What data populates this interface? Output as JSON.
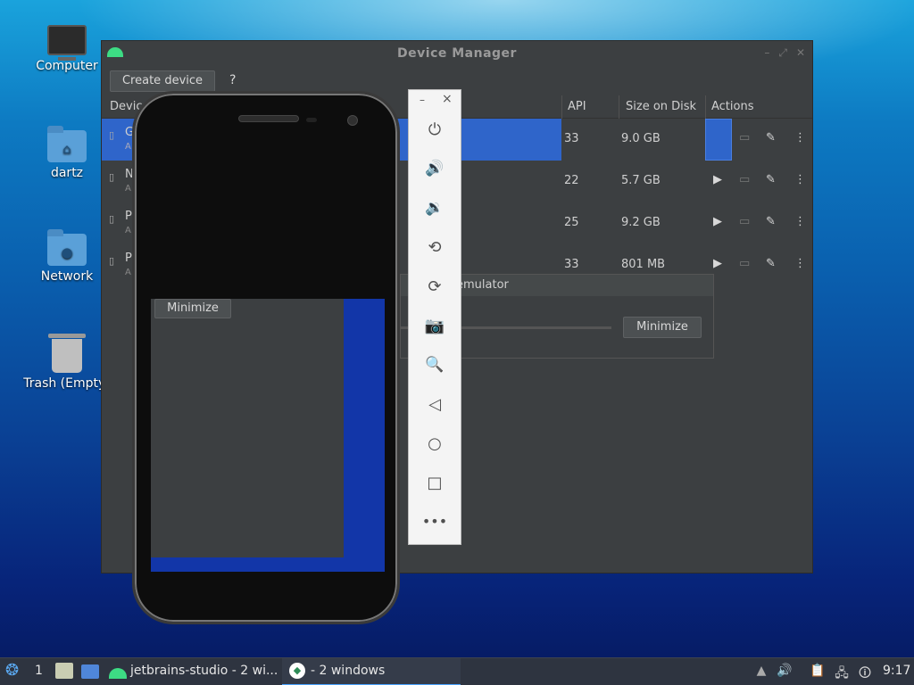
{
  "desktop": {
    "icons": [
      {
        "label": "Computer",
        "icon": "computer-icon"
      },
      {
        "label": "dartz",
        "icon": "home-folder-icon"
      },
      {
        "label": "Network",
        "icon": "network-folder-icon"
      },
      {
        "label": "Trash (Empty)",
        "icon": "trash-icon"
      }
    ]
  },
  "device_manager": {
    "title": "Device Manager",
    "create_button": "Create device",
    "help": "?",
    "columns": {
      "device": "Device",
      "api": "API",
      "size": "Size on Disk",
      "actions": "Actions"
    },
    "rows": [
      {
        "name": "G",
        "sub": "A",
        "api": "33",
        "size": "9.0 GB",
        "selected": true
      },
      {
        "name": "N",
        "sub": "A",
        "api": "22",
        "size": "5.7 GB",
        "selected": false
      },
      {
        "name": "P",
        "sub": "A",
        "api": "25",
        "size": "9.2 GB",
        "selected": false
      },
      {
        "name": "P",
        "sub": "A",
        "api": "33",
        "size": "801 MB",
        "selected": false
      }
    ]
  },
  "launch_dialog": {
    "title": "L",
    "title_tail": "emulator",
    "minimize_label": "Minimize"
  },
  "phone_screen": {
    "minimize_label": "Minimize"
  },
  "emulator_toolbar": {
    "minimize": "–",
    "close": "×",
    "buttons": [
      "power-icon",
      "volume-up-icon",
      "volume-down-icon",
      "rotate-left-icon",
      "rotate-right-icon",
      "camera-icon",
      "zoom-icon",
      "back-icon",
      "home-icon",
      "overview-icon",
      "more-icon"
    ]
  },
  "taskbar": {
    "workspace": "1",
    "task1": "jetbrains-studio - 2 wi...",
    "task2": "- 2 windows",
    "clock": "9:17",
    "accent": "#4aa3ff"
  }
}
